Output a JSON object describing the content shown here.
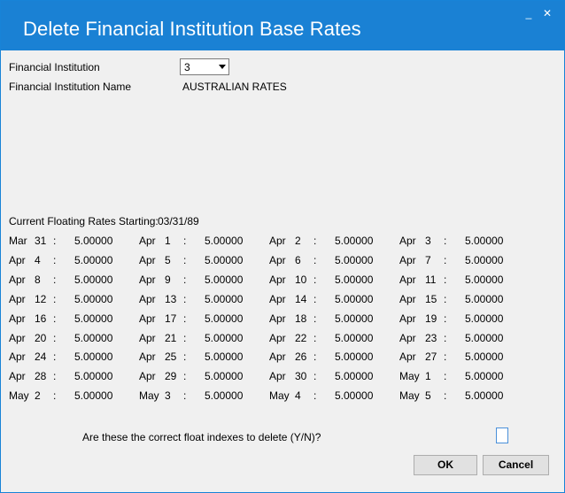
{
  "window": {
    "title": "Delete Financial Institution Base Rates",
    "minimize_glyph": "_",
    "close_glyph": "✕"
  },
  "form": {
    "institution_label": "Financial Institution",
    "institution_value": "3",
    "institution_name_label": "Financial Institution Name",
    "institution_name_value": "AUSTRALIAN RATES",
    "rates_start_label": "Current Floating Rates Starting:",
    "rates_start_value": "03/31/89",
    "question": "Are these the correct float indexes to delete (Y/N)?",
    "answer_value": ""
  },
  "rates": [
    {
      "month": "Mar",
      "day": "31",
      "value": "5.00000"
    },
    {
      "month": "Apr",
      "day": "1",
      "value": "5.00000"
    },
    {
      "month": "Apr",
      "day": "2",
      "value": "5.00000"
    },
    {
      "month": "Apr",
      "day": "3",
      "value": "5.00000"
    },
    {
      "month": "Apr",
      "day": "4",
      "value": "5.00000"
    },
    {
      "month": "Apr",
      "day": "5",
      "value": "5.00000"
    },
    {
      "month": "Apr",
      "day": "6",
      "value": "5.00000"
    },
    {
      "month": "Apr",
      "day": "7",
      "value": "5.00000"
    },
    {
      "month": "Apr",
      "day": "8",
      "value": "5.00000"
    },
    {
      "month": "Apr",
      "day": "9",
      "value": "5.00000"
    },
    {
      "month": "Apr",
      "day": "10",
      "value": "5.00000"
    },
    {
      "month": "Apr",
      "day": "11",
      "value": "5.00000"
    },
    {
      "month": "Apr",
      "day": "12",
      "value": "5.00000"
    },
    {
      "month": "Apr",
      "day": "13",
      "value": "5.00000"
    },
    {
      "month": "Apr",
      "day": "14",
      "value": "5.00000"
    },
    {
      "month": "Apr",
      "day": "15",
      "value": "5.00000"
    },
    {
      "month": "Apr",
      "day": "16",
      "value": "5.00000"
    },
    {
      "month": "Apr",
      "day": "17",
      "value": "5.00000"
    },
    {
      "month": "Apr",
      "day": "18",
      "value": "5.00000"
    },
    {
      "month": "Apr",
      "day": "19",
      "value": "5.00000"
    },
    {
      "month": "Apr",
      "day": "20",
      "value": "5.00000"
    },
    {
      "month": "Apr",
      "day": "21",
      "value": "5.00000"
    },
    {
      "month": "Apr",
      "day": "22",
      "value": "5.00000"
    },
    {
      "month": "Apr",
      "day": "23",
      "value": "5.00000"
    },
    {
      "month": "Apr",
      "day": "24",
      "value": "5.00000"
    },
    {
      "month": "Apr",
      "day": "25",
      "value": "5.00000"
    },
    {
      "month": "Apr",
      "day": "26",
      "value": "5.00000"
    },
    {
      "month": "Apr",
      "day": "27",
      "value": "5.00000"
    },
    {
      "month": "Apr",
      "day": "28",
      "value": "5.00000"
    },
    {
      "month": "Apr",
      "day": "29",
      "value": "5.00000"
    },
    {
      "month": "Apr",
      "day": "30",
      "value": "5.00000"
    },
    {
      "month": "May",
      "day": "1",
      "value": "5.00000"
    },
    {
      "month": "May",
      "day": "2",
      "value": "5.00000"
    },
    {
      "month": "May",
      "day": "3",
      "value": "5.00000"
    },
    {
      "month": "May",
      "day": "4",
      "value": "5.00000"
    },
    {
      "month": "May",
      "day": "5",
      "value": "5.00000"
    }
  ],
  "rate_separator": ":",
  "buttons": {
    "ok_label": "OK",
    "cancel_label": "Cancel"
  },
  "colors": {
    "titlebar": "#1a81d4",
    "window_bg": "#f0f0f0"
  }
}
